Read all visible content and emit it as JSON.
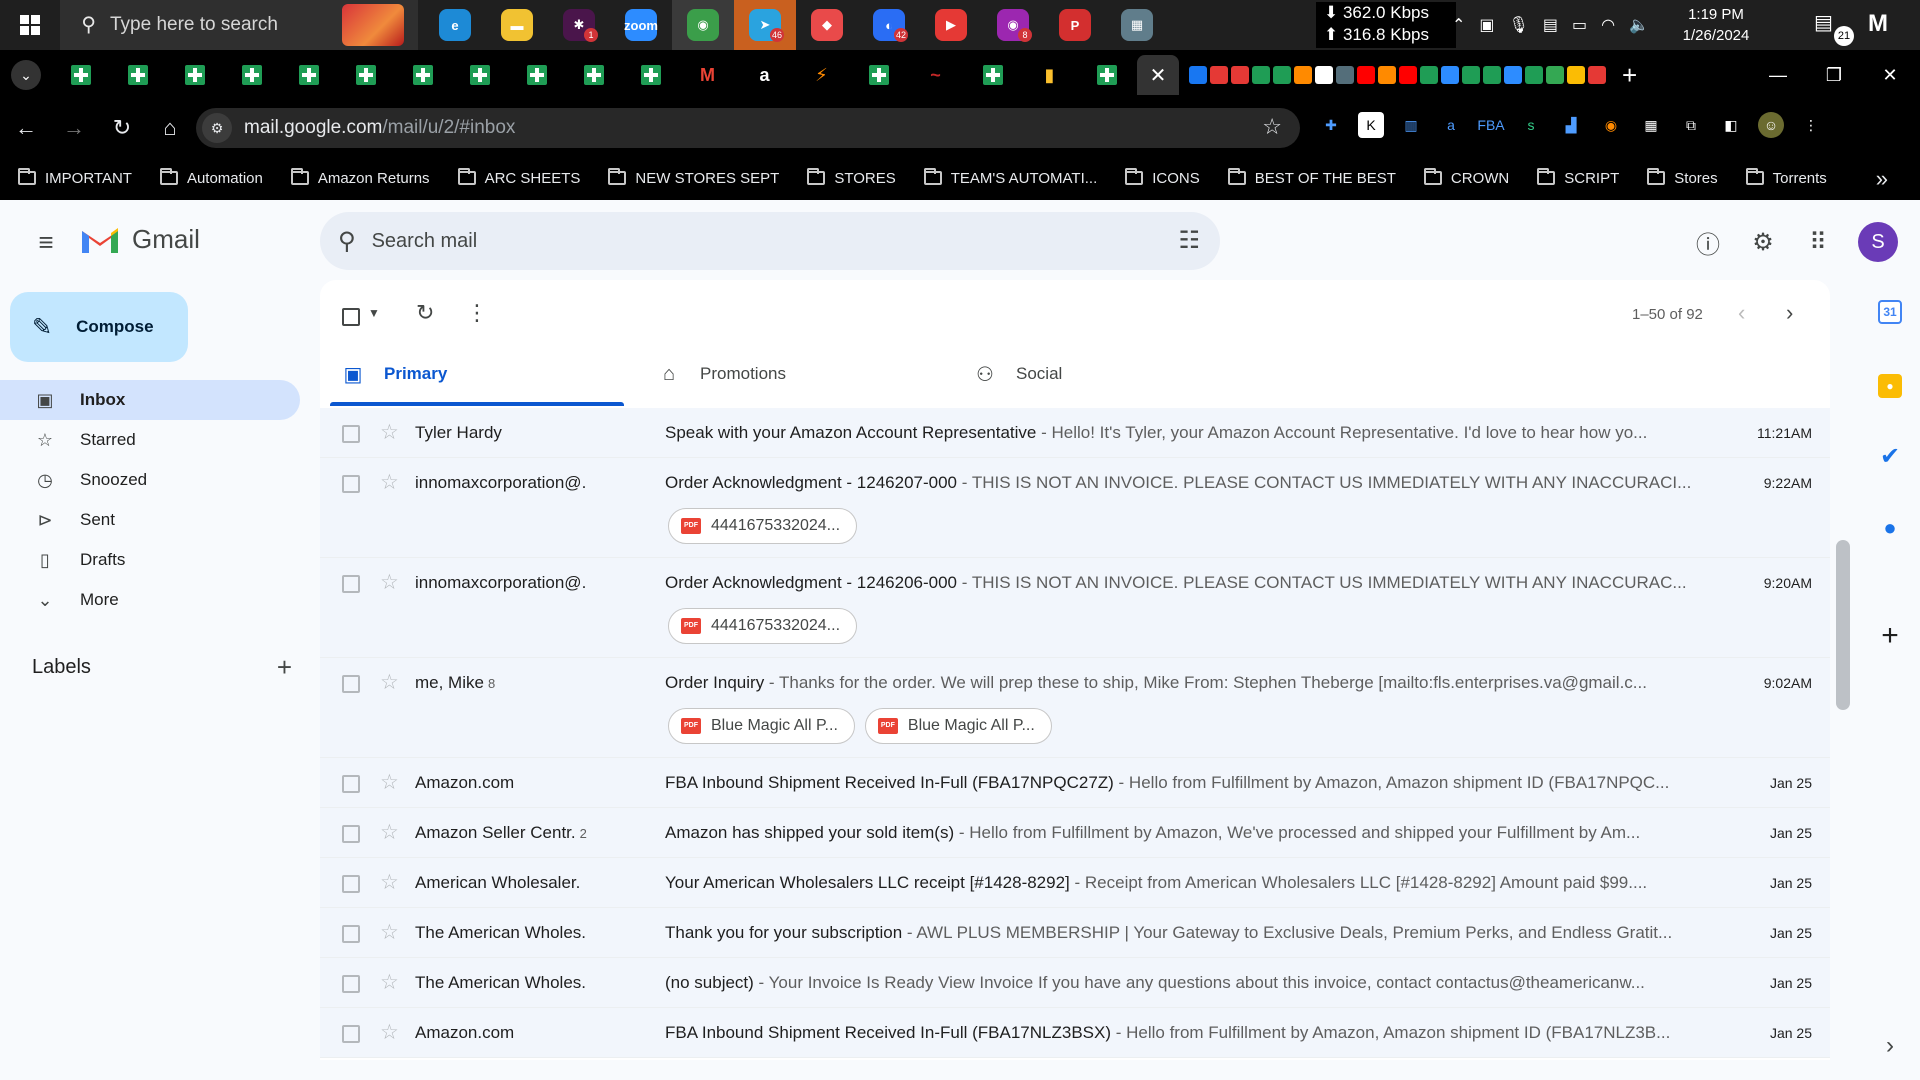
{
  "taskbar": {
    "search_placeholder": "Type here to search",
    "apps": [
      {
        "icon": "edge-icon",
        "color": "#1d8ad6",
        "glyph": "e"
      },
      {
        "icon": "file-explorer-icon",
        "color": "#f1c232",
        "glyph": "▬"
      },
      {
        "icon": "slack-icon",
        "color": "#4a154b",
        "glyph": "✱",
        "badge": "1"
      },
      {
        "icon": "zoom-icon",
        "color": "#2d8cff",
        "glyph": "zoom"
      },
      {
        "icon": "chrome-icon",
        "color": "#3b9e4a",
        "glyph": "◉",
        "active": true
      },
      {
        "icon": "telegram-icon",
        "color": "#2aa3df",
        "glyph": "➤",
        "badge": "46",
        "highlight": true
      },
      {
        "icon": "app-icon",
        "color": "#e94a4a",
        "glyph": "◆"
      },
      {
        "icon": "messenger-icon",
        "color": "#2a6df4",
        "glyph": "◐",
        "badge": "42"
      },
      {
        "icon": "play-icon",
        "color": "#e53935",
        "glyph": "▶"
      },
      {
        "icon": "messenger-alt-icon",
        "color": "#9c27b0",
        "glyph": "◉",
        "badge": "8"
      },
      {
        "icon": "p-icon",
        "color": "#d32f2f",
        "glyph": "P"
      },
      {
        "icon": "calculator-icon",
        "color": "#607d8b",
        "glyph": "▦"
      }
    ],
    "net_down": "⬇ 362.0 Kbps",
    "net_up": "⬆ 316.8 Kbps",
    "time": "1:19 PM",
    "date": "1/26/2024",
    "notifications": "21"
  },
  "browser": {
    "url_host": "mail.google.com",
    "url_path": "/mail/u/2/#inbox",
    "bookmarks": [
      "IMPORTANT",
      "Automation",
      "Amazon Returns",
      "ARC SHEETS",
      "NEW STORES SEPT",
      "STORES",
      "TEAM'S AUTOMATI...",
      "ICONS",
      "BEST OF THE BEST",
      "CROWN",
      "SCRIPT",
      "Stores",
      "Torrents"
    ]
  },
  "gmail": {
    "brand": "Gmail",
    "search_placeholder": "Search mail",
    "avatar_letter": "S",
    "compose_label": "Compose",
    "nav": [
      {
        "label": "Inbox",
        "icon": "inbox-icon",
        "glyph": "▣",
        "selected": true
      },
      {
        "label": "Starred",
        "icon": "star-icon",
        "glyph": "☆"
      },
      {
        "label": "Snoozed",
        "icon": "clock-icon",
        "glyph": "◷"
      },
      {
        "label": "Sent",
        "icon": "send-icon",
        "glyph": "⊳"
      },
      {
        "label": "Drafts",
        "icon": "draft-icon",
        "glyph": "▯"
      },
      {
        "label": "More",
        "icon": "chevron-down-icon",
        "glyph": "⌄"
      }
    ],
    "labels_title": "Labels",
    "pagination": "1–50 of 92",
    "tabs": [
      {
        "label": "Primary",
        "icon": "inbox-icon",
        "glyph": "▣",
        "selected": true
      },
      {
        "label": "Promotions",
        "icon": "tag-icon",
        "glyph": "⌂"
      },
      {
        "label": "Social",
        "icon": "people-icon",
        "glyph": "⚇"
      }
    ],
    "emails": [
      {
        "sender": "Tyler Hardy",
        "count": "",
        "subject": "Speak with your Amazon Account Representative",
        "snippet": " - Hello! It's Tyler, your Amazon Account Representative. I'd love to hear how yo...",
        "date": "11:21AM",
        "attachments": []
      },
      {
        "sender": "innomaxcorporation@.",
        "count": "",
        "subject": "Order Acknowledgment - 1246207-000",
        "snippet": " - THIS IS NOT AN INVOICE. PLEASE CONTACT US IMMEDIATELY WITH ANY INACCURACI...",
        "date": "9:22AM",
        "attachments": [
          "4441675332024..."
        ]
      },
      {
        "sender": "innomaxcorporation@.",
        "count": "",
        "subject": "Order Acknowledgment - 1246206-000",
        "snippet": " - THIS IS NOT AN INVOICE. PLEASE CONTACT US IMMEDIATELY WITH ANY INACCURAC...",
        "date": "9:20AM",
        "attachments": [
          "4441675332024..."
        ]
      },
      {
        "sender": "me, Mike",
        "count": "8",
        "subject": "Order Inquiry",
        "snippet": " - Thanks for the order. We will prep these to ship, Mike From: Stephen Theberge [mailto:fls.enterprises.va@gmail.c...",
        "date": "9:02AM",
        "attachments": [
          "Blue Magic All P...",
          "Blue Magic All P..."
        ]
      },
      {
        "sender": "Amazon.com",
        "count": "",
        "subject": "FBA Inbound Shipment Received In-Full (FBA17NPQC27Z)",
        "snippet": " - Hello from Fulfillment by Amazon, Amazon shipment ID (FBA17NPQC...",
        "date": "Jan 25",
        "attachments": []
      },
      {
        "sender": "Amazon Seller Centr.",
        "count": "2",
        "subject": "Amazon has shipped your sold item(s)",
        "snippet": " - Hello from Fulfillment by Amazon, We've processed and shipped your Fulfillment by Am...",
        "date": "Jan 25",
        "attachments": []
      },
      {
        "sender": "American Wholesaler.",
        "count": "",
        "subject": "Your American Wholesalers LLC receipt [#1428-8292]",
        "snippet": " - Receipt from American Wholesalers LLC [#1428-8292] Amount paid $99....",
        "date": "Jan 25",
        "attachments": []
      },
      {
        "sender": "The American Wholes.",
        "count": "",
        "subject": "Thank you for your subscription",
        "snippet": " - AWL PLUS MEMBERSHIP | Your Gateway to Exclusive Deals, Premium Perks, and Endless Gratit...",
        "date": "Jan 25",
        "attachments": []
      },
      {
        "sender": "The American Wholes.",
        "count": "",
        "subject": "(no subject)",
        "snippet": " - Your Invoice Is Ready View Invoice If you have any questions about this invoice, contact contactus@theamericanw...",
        "date": "Jan 25",
        "attachments": []
      },
      {
        "sender": "Amazon.com",
        "count": "",
        "subject": "FBA Inbound Shipment Received In-Full (FBA17NLZ3BSX)",
        "snippet": " - Hello from Fulfillment by Amazon, Amazon shipment ID (FBA17NLZ3B...",
        "date": "Jan 25",
        "attachments": []
      }
    ]
  }
}
